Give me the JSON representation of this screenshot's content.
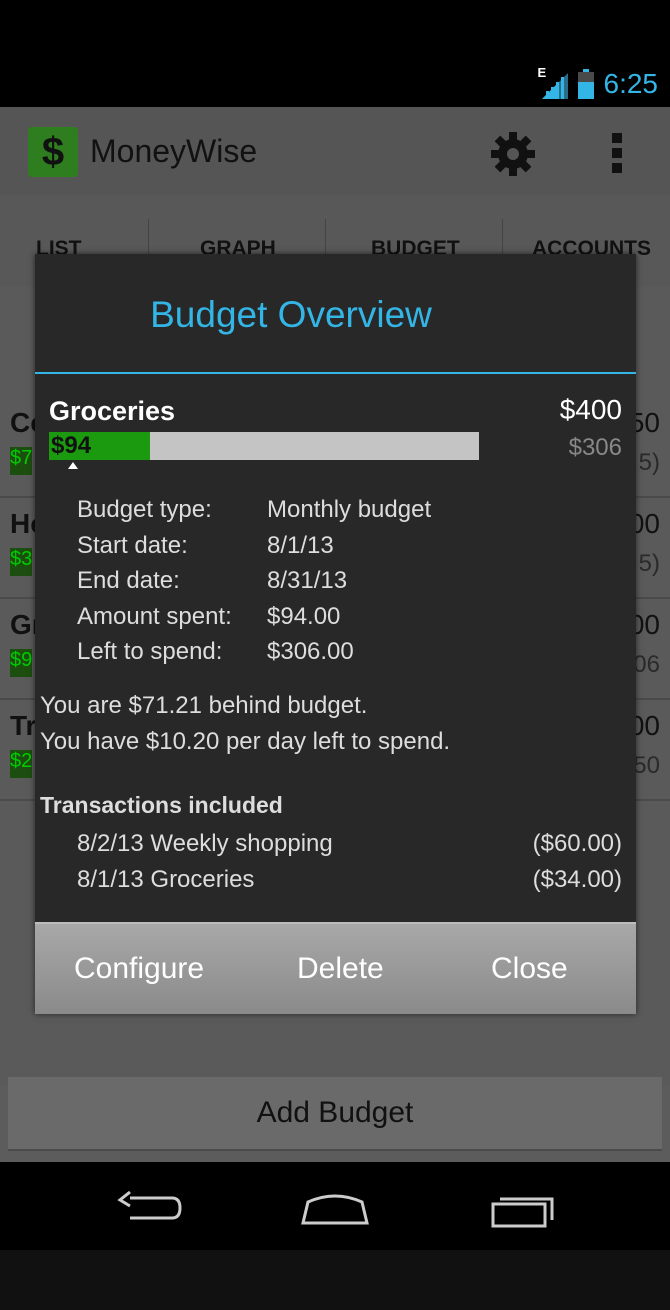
{
  "status_bar": {
    "network_label": "E",
    "time": "6:25",
    "icons": [
      "signal-icon",
      "battery-icon"
    ],
    "accent_color": "#33b5e5"
  },
  "app": {
    "title": "MoneyWise",
    "logo_glyph": "$",
    "icons": [
      "settings-gear-icon",
      "overflow-menu-icon"
    ]
  },
  "tabs": [
    {
      "label": "LIST"
    },
    {
      "label": "GRAPH"
    },
    {
      "label": "BUDGET"
    },
    {
      "label": "ACCOUNTS"
    }
  ],
  "background_list": {
    "rows": [
      {
        "letter": "Co",
        "amount": "50",
        "amount2": "5)",
        "green_label": "$7"
      },
      {
        "letter": "Ho",
        "amount": "00",
        "amount2": "5)",
        "green_label": "$3"
      },
      {
        "letter": "Gr",
        "amount": "00",
        "amount2": "06",
        "green_label": "$9"
      },
      {
        "letter": "Tr",
        "amount": "00",
        "amount2": "50",
        "green_label": "$2"
      }
    ],
    "add_button": "Add Budget"
  },
  "dialog": {
    "title": "Budget Overview",
    "category": "Groceries",
    "total": "$400",
    "remaining": "$306",
    "spent_label": "$94",
    "spent_fraction": 0.235,
    "bar_color": "#1b9a0f",
    "details": [
      {
        "label": "Budget type:",
        "value": "Monthly budget"
      },
      {
        "label": "Start date:",
        "value": "8/1/13"
      },
      {
        "label": "End date:",
        "value": "8/31/13"
      },
      {
        "label": "Amount spent:",
        "value": "$94.00"
      },
      {
        "label": "Left to spend:",
        "value": "$306.00"
      }
    ],
    "summary_lines": [
      "You are $71.21 behind budget.",
      "You have $10.20 per day left to spend."
    ],
    "transactions_heading": "Transactions included",
    "transactions": [
      {
        "text": "8/2/13 Weekly shopping",
        "amount": "($60.00)"
      },
      {
        "text": "8/1/13 Groceries",
        "amount": "($34.00)"
      }
    ],
    "buttons": {
      "configure": "Configure",
      "delete": "Delete",
      "close": "Close"
    }
  },
  "nav_bar": {
    "icons": [
      "back-icon",
      "home-icon",
      "recent-apps-icon"
    ]
  }
}
